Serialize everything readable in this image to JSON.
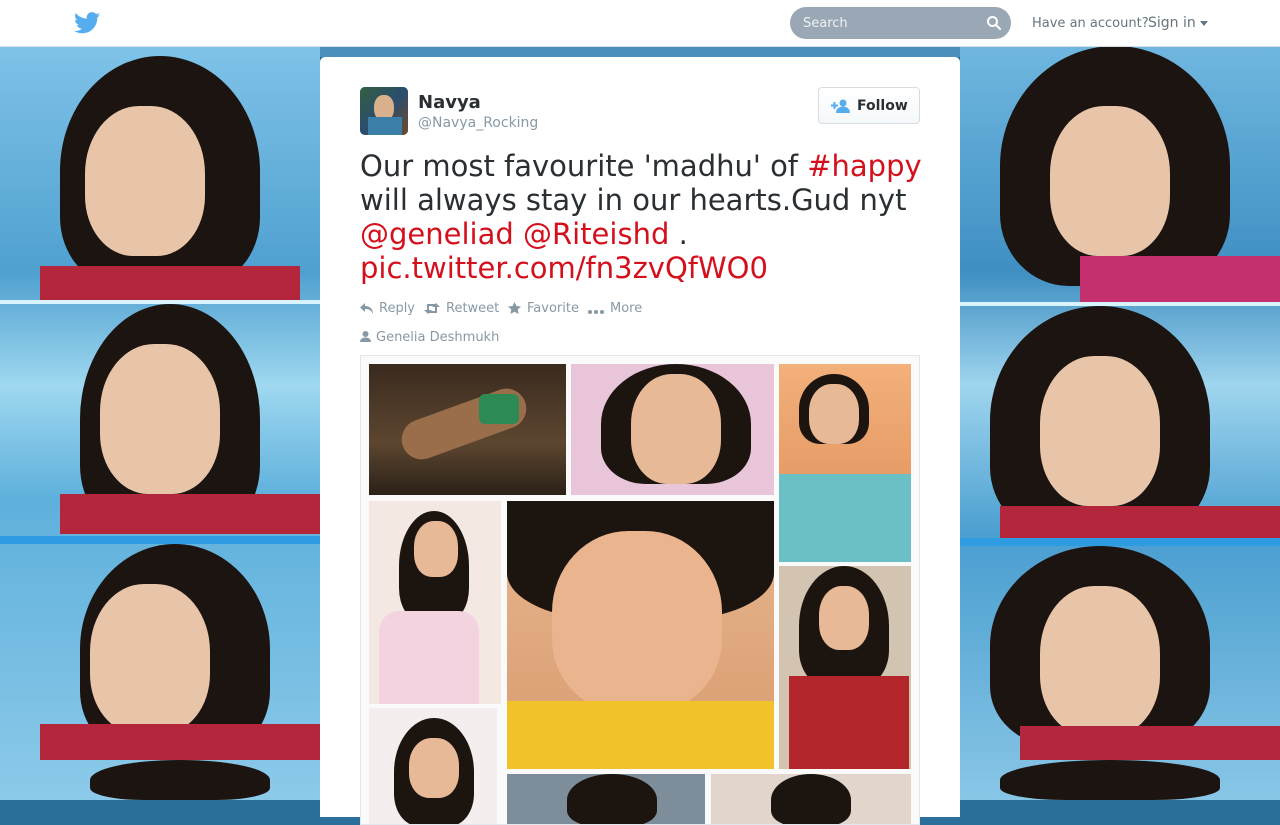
{
  "topbar": {
    "search_placeholder": "Search",
    "have_account": "Have an account?",
    "signin_label": "Sign in"
  },
  "tweet": {
    "name": "Navya",
    "handle": "@Navya_Rocking",
    "follow_label": "Follow",
    "text_parts": {
      "t1": "Our most favourite 'madhu' of ",
      "hashtag": "#happy",
      "t2": " will always stay in our hearts.Gud nyt ",
      "mention1": "@geneliad",
      "space": " ",
      "mention2": "@Riteishd",
      "t3": " . ",
      "link": "pic.twitter.com/fn3zvQfWO0"
    },
    "actions": {
      "reply": "Reply",
      "retweet": "Retweet",
      "favorite": "Favorite",
      "more": "More"
    },
    "tagged_person": "Genelia Deshmukh"
  },
  "colors": {
    "brand": "#55acee",
    "highlight": "#d5101d",
    "muted": "#8899a6"
  },
  "icons": [
    "twitter-bird-icon",
    "search-icon",
    "follow-person-icon",
    "reply-icon",
    "retweet-icon",
    "star-icon",
    "more-dots-icon",
    "person-icon"
  ]
}
